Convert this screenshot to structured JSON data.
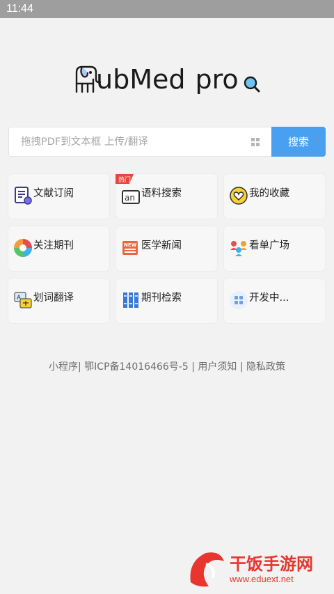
{
  "status_bar": {
    "time": "11:44"
  },
  "logo": {
    "text_main": "ubMed",
    "text_pro": "pro"
  },
  "search": {
    "placeholder": "拖拽PDF到文本框 上传/翻译",
    "button_label": "搜索"
  },
  "tiles": [
    {
      "label": "文献订阅",
      "icon": "document-subscribe-icon"
    },
    {
      "label": "语料搜索",
      "icon": "corpus-search-icon",
      "badge": "热门"
    },
    {
      "label": "我的收藏",
      "icon": "heart-icon"
    },
    {
      "label": "关注期刊",
      "icon": "aperture-icon"
    },
    {
      "label": "医学新闻",
      "icon": "news-icon"
    },
    {
      "label": "看单广场",
      "icon": "people-icon"
    },
    {
      "label": "划词翻译",
      "icon": "translate-icon"
    },
    {
      "label": "期刊检索",
      "icon": "journal-index-icon"
    },
    {
      "label": "开发中...",
      "icon": "grid-icon"
    }
  ],
  "footer": {
    "text": "小程序| 鄂ICP备14016466号-5 | 用户须知 | 隐私政策"
  },
  "watermark": {
    "brand": "干饭手游网",
    "url": "www.eduext.net"
  },
  "colors": {
    "accent": "#49a0f0",
    "background": "#f2f2f2"
  }
}
